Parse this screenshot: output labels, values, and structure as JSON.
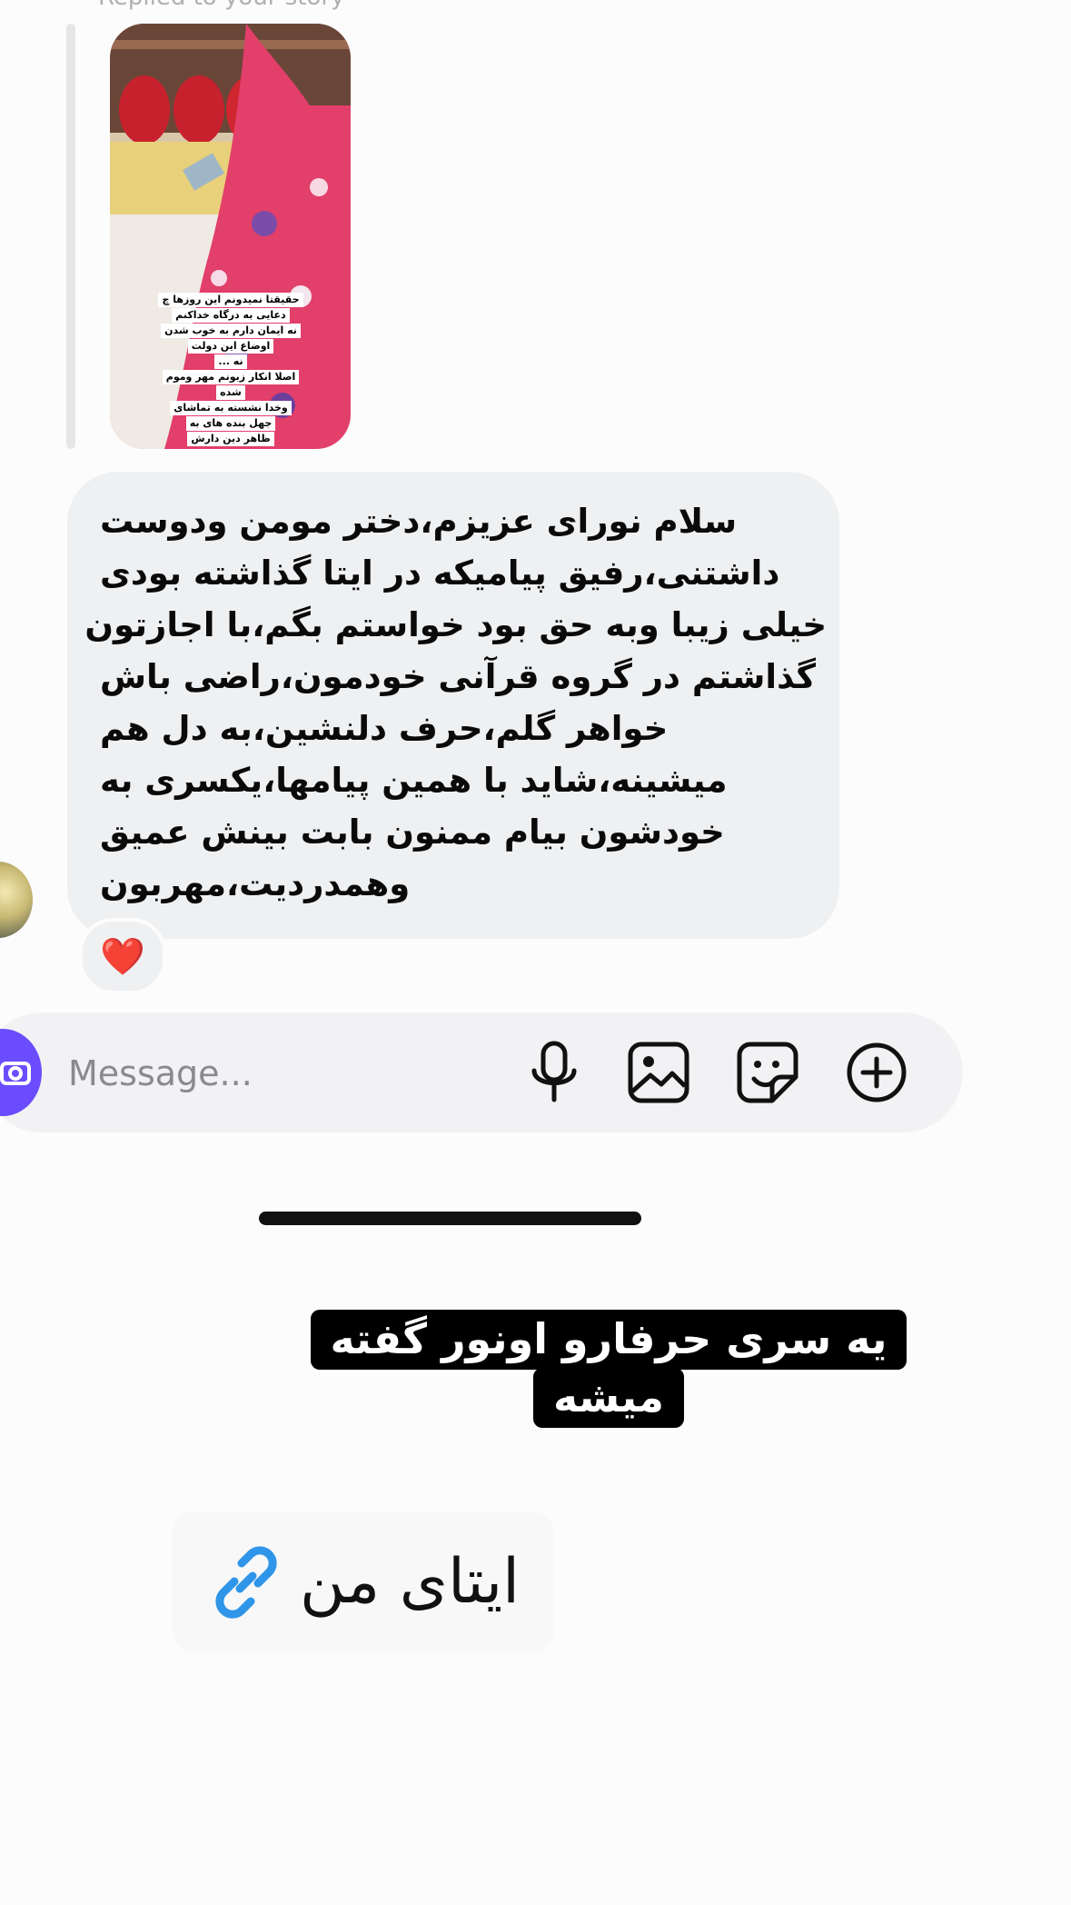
{
  "thread": {
    "reply_label": "Replied to your story",
    "story_caption_lines": [
      "حقیقتا نمیدونم این روزها چ",
      "دعایی به درگاه خداکنم",
      "نه ایمان دارم به خوب شدن",
      "اوضاع این دولت",
      "نه ...",
      "اصلا انکار زبونم مهر وموم",
      "شده",
      "وخدا نشسته به تماشای",
      "جهل بنده های به",
      "ظاهر دین دارش"
    ],
    "message_lines": [
      "سلام نورای عزیزم،دختر مومن ودوست",
      "داشتنی،رفیق پیامیکه در ایتا گذاشته بودی",
      "خیلی زیبا وبه حق بود خواستم بگم،با اجازتون",
      "گذاشتم در گروه قرآنی خودمون،راضی باش",
      "خواهر گلم،حرف دلنشین،به دل هم",
      "میشینه،شاید با همین پیامها،یکسری به",
      "خودشون بیام ممنون بابت بینش عمیق",
      "وهمدردیت،مهربون"
    ],
    "reaction": "❤️"
  },
  "composer": {
    "placeholder": "Message...",
    "icons": [
      "camera-icon",
      "microphone-icon",
      "gallery-icon",
      "sticker-icon",
      "add-icon"
    ],
    "accent_color": "#6b4dff"
  },
  "overlay": {
    "caption_line1": "یه سری حرفارو اونور گفته",
    "caption_line2": "میشه",
    "link_text": "ایتای من",
    "link_icon_color": "#2f95e8"
  }
}
